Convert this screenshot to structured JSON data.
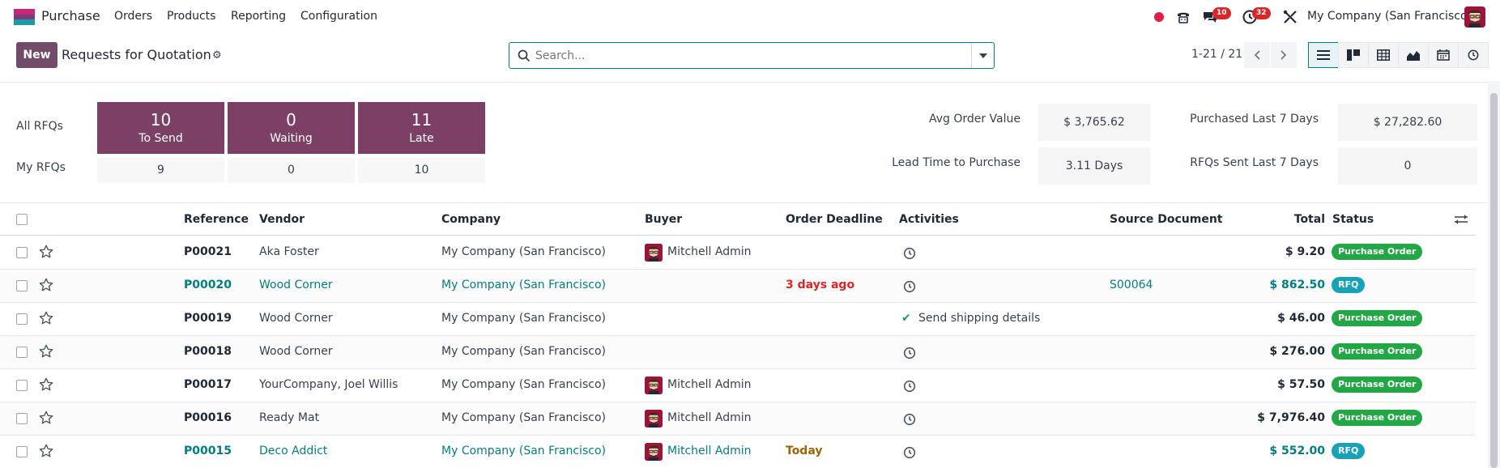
{
  "nav": {
    "app_name": "Purchase",
    "menu": [
      "Orders",
      "Products",
      "Reporting",
      "Configuration"
    ],
    "messages_count": "10",
    "activities_count": "32",
    "company": "My Company (San Francisco)"
  },
  "control": {
    "new_label": "New",
    "title": "Requests for Quotation",
    "search_placeholder": "Search...",
    "pager": "1-21 / 21"
  },
  "dashboard": {
    "all_label": "All RFQs",
    "my_label": "My RFQs",
    "tiles": [
      {
        "count": "10",
        "label": "To Send",
        "mine": "9"
      },
      {
        "count": "0",
        "label": "Waiting",
        "mine": "0"
      },
      {
        "count": "11",
        "label": "Late",
        "mine": "10"
      }
    ],
    "kpis": {
      "avg_order_label": "Avg Order Value",
      "avg_order_value": "$ 3,765.62",
      "lead_time_label": "Lead Time to Purchase",
      "lead_time_value": "3.11 Days",
      "purchased_label": "Purchased Last 7 Days",
      "purchased_value": "$ 27,282.60",
      "rfqs_sent_label": "RFQs Sent Last 7 Days",
      "rfqs_sent_value": "0"
    }
  },
  "table": {
    "headers": {
      "reference": "Reference",
      "vendor": "Vendor",
      "company": "Company",
      "buyer": "Buyer",
      "deadline": "Order Deadline",
      "activities": "Activities",
      "source": "Source Document",
      "total": "Total",
      "status": "Status"
    },
    "rows": [
      {
        "ref": "P00021",
        "vendor": "Aka Foster",
        "company": "My Company (San Francisco)",
        "buyer": "Mitchell Admin",
        "deadline": "",
        "activity": "",
        "source": "",
        "total": "$ 9.20",
        "status": "Purchase Order"
      },
      {
        "ref": "P00020",
        "vendor": "Wood Corner",
        "company": "My Company (San Francisco)",
        "buyer": "",
        "deadline": "3 days ago",
        "activity": "",
        "source": "S00064",
        "total": "$ 862.50",
        "status": "RFQ"
      },
      {
        "ref": "P00019",
        "vendor": "Wood Corner",
        "company": "My Company (San Francisco)",
        "buyer": "",
        "deadline": "",
        "activity": "Send shipping details",
        "source": "",
        "total": "$ 46.00",
        "status": "Purchase Order"
      },
      {
        "ref": "P00018",
        "vendor": "Wood Corner",
        "company": "My Company (San Francisco)",
        "buyer": "",
        "deadline": "",
        "activity": "",
        "source": "",
        "total": "$ 276.00",
        "status": "Purchase Order"
      },
      {
        "ref": "P00017",
        "vendor": "YourCompany, Joel Willis",
        "company": "My Company (San Francisco)",
        "buyer": "Mitchell Admin",
        "deadline": "",
        "activity": "",
        "source": "",
        "total": "$ 57.50",
        "status": "Purchase Order"
      },
      {
        "ref": "P00016",
        "vendor": "Ready Mat",
        "company": "My Company (San Francisco)",
        "buyer": "Mitchell Admin",
        "deadline": "",
        "activity": "",
        "source": "",
        "total": "$ 7,976.40",
        "status": "Purchase Order"
      },
      {
        "ref": "P00015",
        "vendor": "Deco Addict",
        "company": "My Company (San Francisco)",
        "buyer": "Mitchell Admin",
        "deadline": "Today",
        "activity": "",
        "source": "",
        "total": "$ 552.00",
        "status": "RFQ"
      }
    ]
  },
  "colors": {
    "brand": "#714b67",
    "accent": "#017e84",
    "tile": "#7c3f66",
    "po_badge": "#22a745",
    "rfq_badge": "#17a2b8"
  }
}
